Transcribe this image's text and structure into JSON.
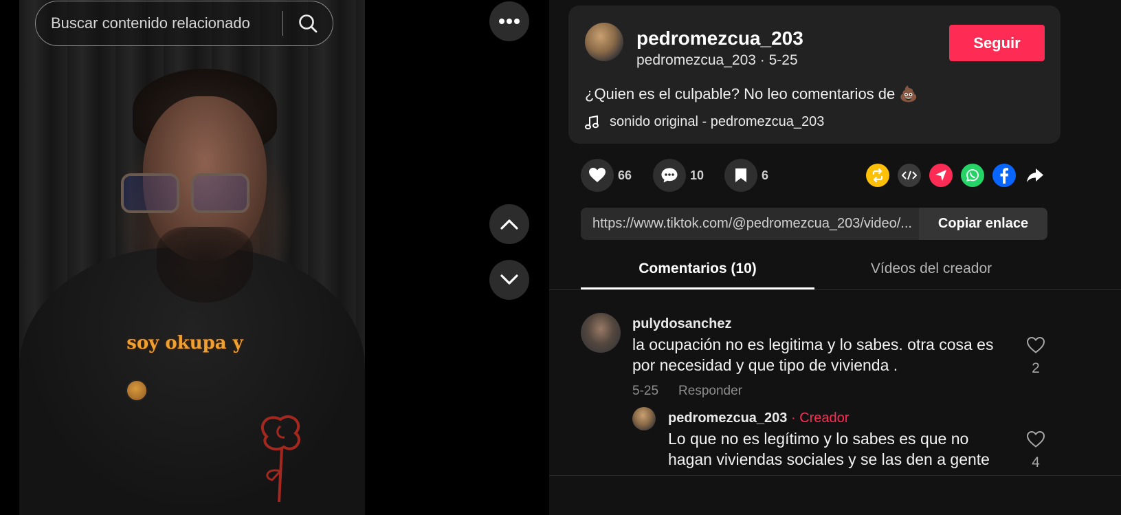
{
  "search": {
    "placeholder": "Buscar contenido relacionado"
  },
  "video": {
    "subtitle": "soy okupa y"
  },
  "post": {
    "username": "pedromezcua_203",
    "meta": "pedromezcua_203 · 5-25",
    "follow_label": "Seguir",
    "description": "¿Quien es el culpable? No leo comentarios de 💩",
    "music": "sonido original - pedromezcua_203"
  },
  "actions": {
    "likes": "66",
    "comments": "10",
    "saves": "6",
    "share_icons": [
      "repost-icon",
      "embed-icon",
      "send-to-friends-icon",
      "whatsapp-icon",
      "facebook-icon",
      "share-arrow-icon"
    ],
    "colors": {
      "repost": "#ffc107",
      "embed": "#3a3a3a",
      "send": "#fe2c55",
      "whatsapp": "#25d366",
      "facebook": "#0866ff"
    }
  },
  "link": {
    "url": "https://www.tiktok.com/@pedromezcua_203/video/...",
    "copy_label": "Copiar enlace"
  },
  "tabs": [
    "Comentarios (10)",
    "Vídeos del creador"
  ],
  "comments": [
    {
      "user": "pulydosanchez",
      "lines": [
        "la ocupación no es legitima y lo sabes. otra cosa es",
        "por necesidad y que tipo de vivienda ."
      ],
      "date": "5-25",
      "reply_label": "Responder",
      "likes": "2"
    },
    {
      "user": "pedromezcua_203",
      "creator_tag": "Creador",
      "lines": [
        "Lo que no es legítimo y lo sabes es que no",
        "hagan viviendas sociales y se las den a gente"
      ],
      "likes": "4"
    }
  ],
  "brand_colors": {
    "accent": "#fe2c55",
    "background": "#121212",
    "card": "#222222"
  }
}
